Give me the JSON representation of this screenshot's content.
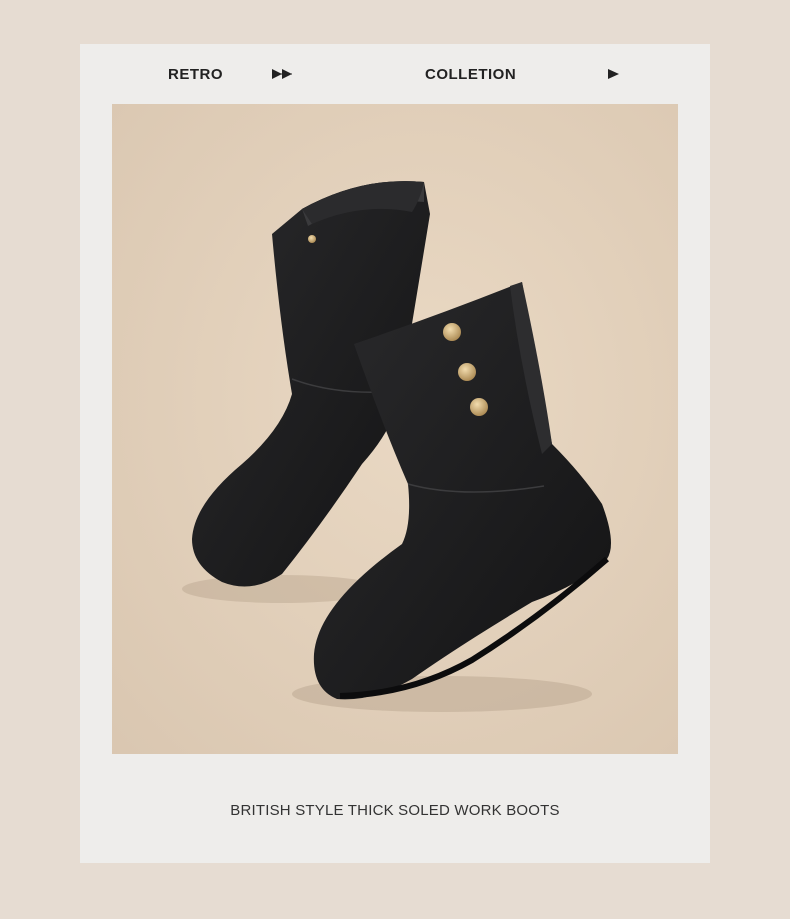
{
  "header": {
    "left_word": "RETRO",
    "right_word": "COLLETION",
    "arrow_icon_1": "double-play-arrow-icon",
    "arrow_icon_2": "play-arrow-icon"
  },
  "product": {
    "image_subject": "pair of black suede mid-calf boots with gold buttons",
    "caption": "BRITISH STYLE THICK SOLED WORK BOOTS"
  },
  "colors": {
    "page_background": "#e6dcd2",
    "card_background": "#eeedeb",
    "photo_background": "#e3d3c0",
    "boot": "#1a1a1c",
    "button_gold": "#c9ab78",
    "text": "#222222"
  }
}
